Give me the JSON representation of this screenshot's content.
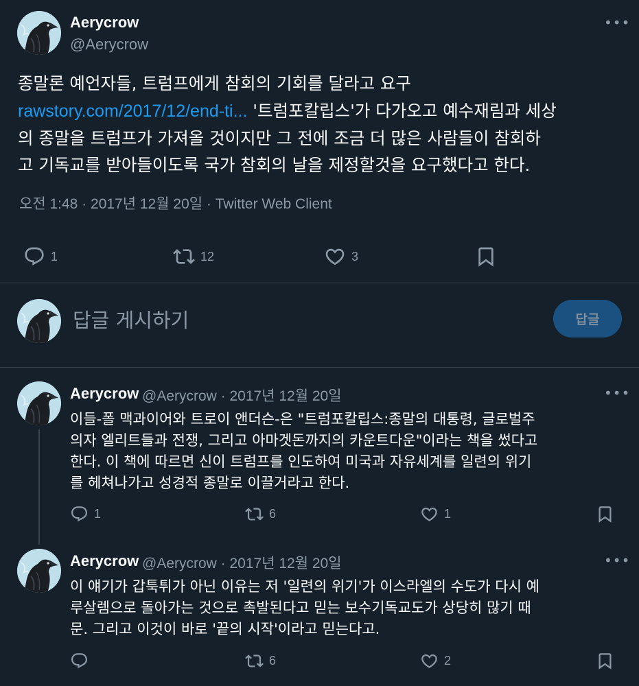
{
  "main_tweet": {
    "author_name": "Aerycrow",
    "author_handle": "@Aerycrow",
    "text_line1": "종말론 예언자들, 트럼프에게 참회의 기회를 달라고 요구",
    "link_text": "rawstory.com/2017/12/end-ti...",
    "text_line2_rest": " '트럼포칼립스'가 다가오고 예수재림과 세상",
    "text_line3": "의 종말을 트럼프가 가져올 것이지만 그 전에 조금 더 많은 사람들이 참회하",
    "text_line4": "고 기독교를 받아들이도록 국가 참회의 날을 제정할것을 요구했다고 한다.",
    "meta": "오전 1:48 · 2017년 12월 20일 · Twitter Web Client",
    "reply_count": "1",
    "retweet_count": "12",
    "like_count": "3"
  },
  "composer": {
    "placeholder": "답글 게시하기",
    "button_label": "답글"
  },
  "replies": [
    {
      "author_name": "Aerycrow",
      "handle_date": "@Aerycrow · 2017년 12월 20일",
      "lines": [
        "이들-폴 맥과이어와 트로이 앤더슨-은 \"트럼포칼립스:종말의 대통령, 글로벌주",
        "의자 엘리트들과 전쟁, 그리고 아마겟돈까지의 카운트다운\"이라는 책을 썼다고",
        "한다. 이 책에 따르면 신이 트럼프를 인도하여 미국과 자유세계를 일련의 위기",
        "를 헤쳐나가고 성경적 종말로 이끌거라고 한다."
      ],
      "reply_count": "1",
      "retweet_count": "6",
      "like_count": "1"
    },
    {
      "author_name": "Aerycrow",
      "handle_date": "@Aerycrow · 2017년 12월 20일",
      "lines": [
        "이 얘기가 갑툭튀가 아닌 이유는 저 '일련의 위기'가 이스라엘의 수도가 다시 예",
        "루살렘으로 돌아가는 것으로 촉발된다고 믿는 보수기독교도가 상당히 많기 때",
        "문. 그리고 이것이 바로 '끝의 시작'이라고 믿는다고."
      ],
      "reply_count": "",
      "retweet_count": "6",
      "like_count": "2"
    }
  ],
  "icons": {
    "more": "more-icon",
    "reply": "reply-icon",
    "retweet": "retweet-icon",
    "like": "heart-icon",
    "bookmark": "bookmark-icon"
  },
  "colors": {
    "background": "#15202b",
    "link": "#1d9bf0",
    "secondary_text": "#8b98a5",
    "reply_button": "#1a5180"
  }
}
